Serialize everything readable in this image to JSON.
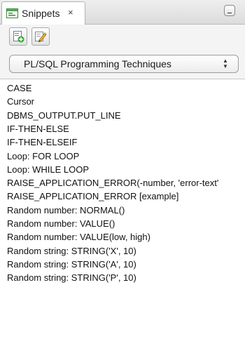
{
  "tab": {
    "label": "Snippets",
    "close_symbol": "×",
    "icon": "snippets-icon"
  },
  "toolbar": {
    "buttons": [
      {
        "icon": "add-snippet-icon"
      },
      {
        "icon": "edit-snippet-icon"
      }
    ]
  },
  "category_select": {
    "value": "PL/SQL Programming Techniques"
  },
  "snippets": [
    "CASE",
    "Cursor",
    "DBMS_OUTPUT.PUT_LINE",
    "IF-THEN-ELSE",
    "IF-THEN-ELSEIF",
    "Loop: FOR LOOP",
    "Loop: WHILE LOOP",
    "RAISE_APPLICATION_ERROR(-number, 'error-text'",
    "RAISE_APPLICATION_ERROR [example]",
    "Random number: NORMAL()",
    "Random number: VALUE()",
    "Random number: VALUE(low, high)",
    "Random string: STRING('X', 10)",
    "Random string: STRING('A', 10)",
    "Random string: STRING('P', 10)"
  ]
}
